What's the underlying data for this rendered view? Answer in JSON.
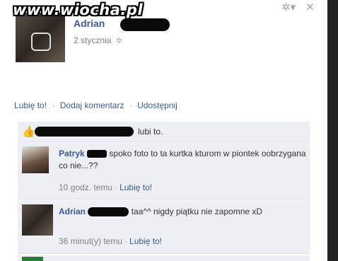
{
  "watermark": "www.wiocha.pl",
  "post": {
    "author": "Adrian",
    "date": "2 stycznia",
    "globe_icon": "globe-icon"
  },
  "top_icons": {
    "settings": "✲▾",
    "close": "✕"
  },
  "actions": {
    "like": "Lubię to!",
    "comment": "Dodaj komentarz",
    "share": "Udostępnij",
    "separator": "·"
  },
  "likes": {
    "text": "lubi to."
  },
  "comments": [
    {
      "author": "Patryk",
      "text": "spoko foto to ta kurtka kturom w piontek oobrzygana co nie...??",
      "time": "10 godz. temu",
      "like": "Lubię to!"
    },
    {
      "author": "Adrian",
      "text": "taa^^ nigdy piątku nie zapomne xD",
      "time": "36 minut(y) temu",
      "like": "Lubię to!"
    }
  ],
  "colors": {
    "link": "#3b5998",
    "comment_bg": "#edeff4",
    "meta": "#808080"
  }
}
